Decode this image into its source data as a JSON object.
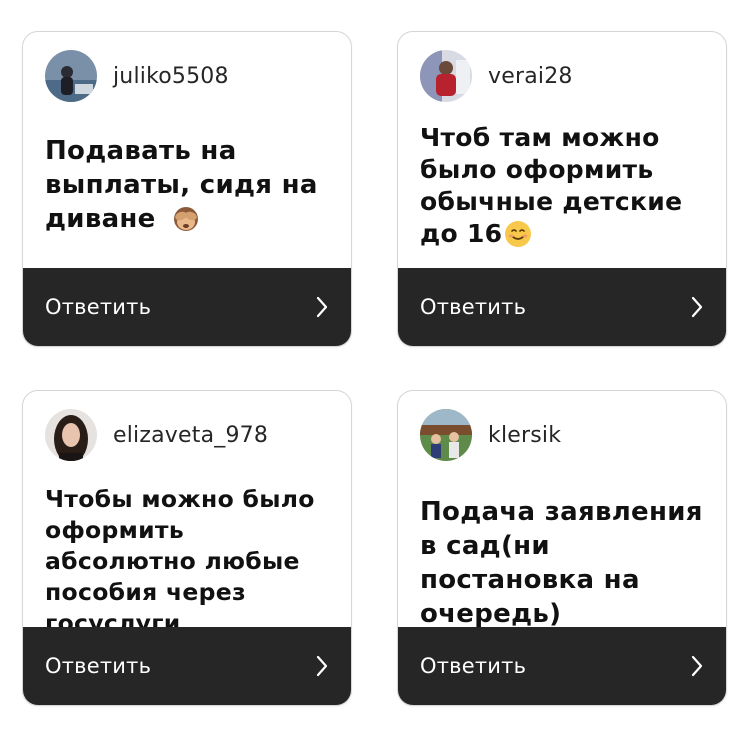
{
  "cards": [
    {
      "username": "juliko5508",
      "question": "Подавать на выплаты, сидя на диване",
      "emoji": "see-no-evil-monkey",
      "reply_label": "Ответить"
    },
    {
      "username": "verai28",
      "question": "Чтоб там можно было оформить обычные детские до 16",
      "emoji": "smiling-face",
      "reply_label": "Ответить"
    },
    {
      "username": "elizaveta_978",
      "question": "Чтобы можно было оформить абсолютно любые пособия через госуслуги",
      "emoji": "",
      "reply_label": "Ответить"
    },
    {
      "username": "klersik",
      "question": "Подача заявления в сад(ни постановка на очередь)",
      "emoji": "",
      "reply_label": "Ответить"
    }
  ],
  "colors": {
    "reply_bar": "#262626",
    "card_border": "#d6d6d6",
    "text": "#111111"
  }
}
